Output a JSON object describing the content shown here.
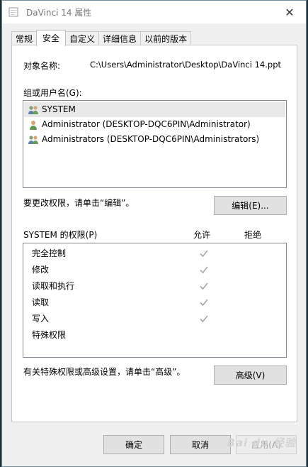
{
  "window": {
    "title": "DaVinci 14 属性",
    "close_label": "✕"
  },
  "tabs": [
    {
      "label": "常规"
    },
    {
      "label": "安全"
    },
    {
      "label": "自定义"
    },
    {
      "label": "详细信息"
    },
    {
      "label": "以前的版本"
    }
  ],
  "object": {
    "label": "对象名称:",
    "value": "C:\\Users\\Administrator\\Desktop\\DaVinci 14.ppt"
  },
  "groups": {
    "label": "组或用户名(G):",
    "items": [
      {
        "label": "SYSTEM"
      },
      {
        "label": "Administrator (DESKTOP-DQC6PIN\\Administrator)"
      },
      {
        "label": "Administrators (DESKTOP-DQC6PIN\\Administrators)"
      }
    ]
  },
  "edit": {
    "hint": "要更改权限，请单击“编辑”。",
    "button_label": "编辑(E)..."
  },
  "permissions": {
    "header": "SYSTEM 的权限(P)",
    "allow_label": "允许",
    "deny_label": "拒绝",
    "rows": [
      {
        "label": "完全控制",
        "allow": true
      },
      {
        "label": "修改",
        "allow": true
      },
      {
        "label": "读取和执行",
        "allow": true
      },
      {
        "label": "读取",
        "allow": true
      },
      {
        "label": "写入",
        "allow": true
      },
      {
        "label": "特殊权限",
        "allow": false
      }
    ]
  },
  "advanced": {
    "hint": "有关特殊权限或高级设置，请单击“高级”。",
    "button_label": "高级(V)"
  },
  "footer": {
    "ok_label": "确定",
    "cancel_label": "取消",
    "apply_label": "应用(A)"
  },
  "watermark": {
    "text": "Bai du 经验"
  }
}
